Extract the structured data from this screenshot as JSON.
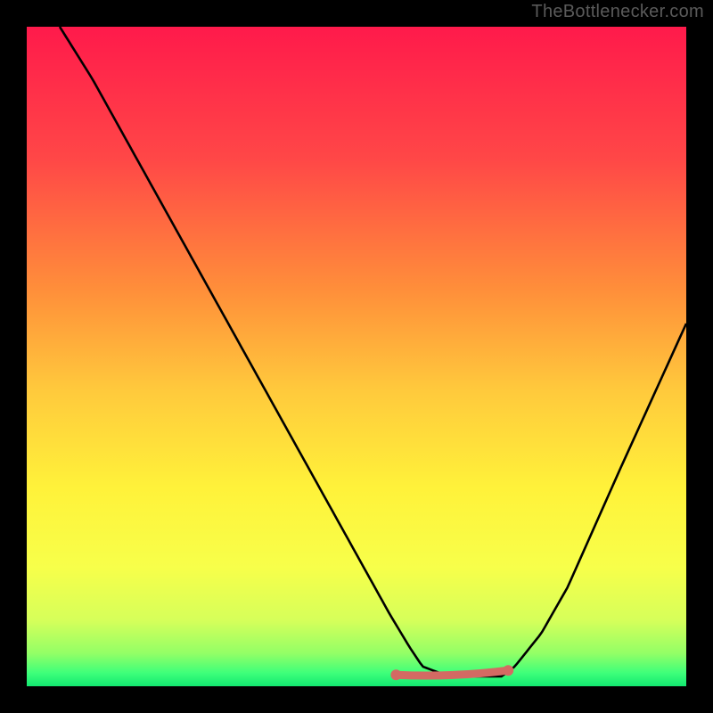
{
  "attribution": "TheBottlenecker.com",
  "chart_data": {
    "type": "line",
    "title": "",
    "xlabel": "",
    "ylabel": "",
    "xlim": [
      0,
      100
    ],
    "ylim": [
      0,
      100
    ],
    "series": [
      {
        "name": "curve",
        "x": [
          5,
          10,
          15,
          20,
          25,
          30,
          35,
          40,
          45,
          50,
          55,
          58,
          60,
          64,
          68,
          72,
          74,
          78,
          82,
          86,
          90,
          95,
          100
        ],
        "y": [
          100,
          92,
          83,
          74,
          65,
          56,
          47,
          38,
          29,
          20,
          11,
          6,
          3,
          1.5,
          1.5,
          1.5,
          3,
          8,
          15,
          24,
          33,
          44,
          55
        ]
      }
    ],
    "flat_band": {
      "x_start": 56,
      "x_end": 73,
      "y": 2.0
    },
    "gradient_stops": [
      {
        "offset": 0,
        "color": "#ff1a4b"
      },
      {
        "offset": 20,
        "color": "#ff4747"
      },
      {
        "offset": 40,
        "color": "#ff8f3a"
      },
      {
        "offset": 55,
        "color": "#ffc93c"
      },
      {
        "offset": 70,
        "color": "#fff23a"
      },
      {
        "offset": 82,
        "color": "#f7ff4a"
      },
      {
        "offset": 90,
        "color": "#d6ff5a"
      },
      {
        "offset": 95,
        "color": "#93ff66"
      },
      {
        "offset": 98,
        "color": "#3eff7a"
      },
      {
        "offset": 100,
        "color": "#12e870"
      }
    ],
    "colors": {
      "curve": "#000000",
      "flat_marker": "#d46a63",
      "background": "#000000"
    }
  }
}
